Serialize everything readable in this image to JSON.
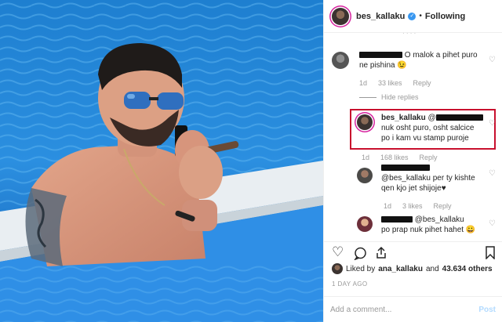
{
  "header": {
    "username": "bes_kallaku",
    "separator": "•",
    "follow_status": "Following"
  },
  "comments": [
    {
      "text_tail": "O malok a pihet puro ne pishina 😉",
      "time": "1d",
      "likes": "33 likes",
      "reply": "Reply",
      "hide_replies": "Hide replies"
    },
    {
      "username": "bes_kallaku",
      "mention_prefix": "@",
      "text": "nuk osht puro, osht salcice po i kam vu stamp puroje",
      "time": "1d",
      "likes": "168 likes",
      "reply": "Reply"
    },
    {
      "text": "@bes_kallaku per ty kishte qen kjo jet shijoje♥",
      "time": "1d",
      "likes": "3 likes",
      "reply": "Reply"
    },
    {
      "mention": "@bes_kallaku",
      "text": "po prap nuk pihet hahet 😀"
    }
  ],
  "likes": {
    "prefix": "Liked by",
    "user": "ana_kallaku",
    "and": "and",
    "count": "43.634 others"
  },
  "time_ago": "1 DAY AGO",
  "add_comment": {
    "placeholder": "Add a comment...",
    "post_label": "Post"
  }
}
